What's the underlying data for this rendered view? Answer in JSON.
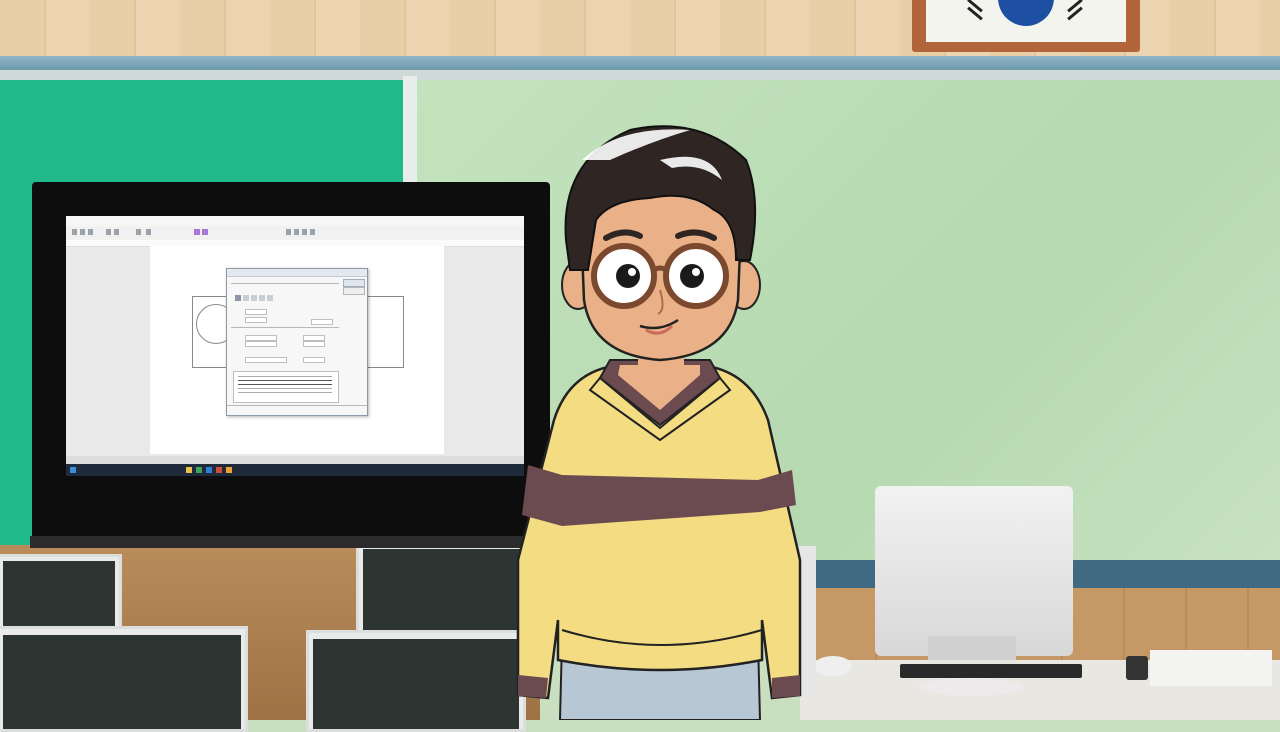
{
  "scene": {
    "description_tags": [
      "classroom-wall",
      "green-chalkboard",
      "wall-tv",
      "computer-monitors",
      "cartoon-character"
    ]
  },
  "tv_screen": {
    "statusbar_text": "",
    "dialog_title": "",
    "dialog_button_ok": "",
    "dialog_button_cancel": ""
  },
  "colors": {
    "chalkboard_green": "#1fb98a",
    "board_light_green": "#c3e3bd",
    "wood": "#e9cfa8",
    "sweater_yellow": "#f3dc82",
    "sweater_stripe": "#6b4a50",
    "hair": "#2f2624",
    "skin": "#eab087",
    "glasses": "#7b4a2e",
    "jeans": "#b7c7d3"
  },
  "icons": {
    "flag": "korean-flag-icon"
  }
}
